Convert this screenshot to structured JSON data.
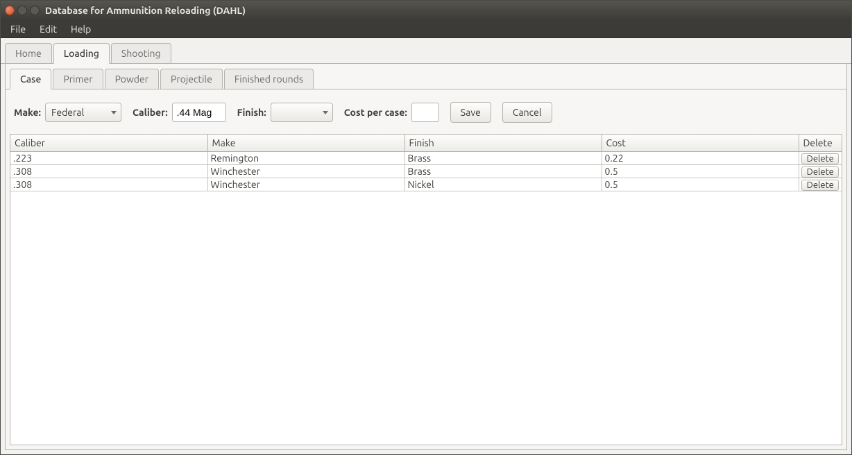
{
  "window": {
    "title": "Database for Ammunition Reloading (DAHL)"
  },
  "menubar": {
    "items": [
      "File",
      "Edit",
      "Help"
    ]
  },
  "primary_tabs": {
    "items": [
      "Home",
      "Loading",
      "Shooting"
    ],
    "active": "Loading"
  },
  "sub_tabs": {
    "items": [
      "Case",
      "Primer",
      "Powder",
      "Projectile",
      "Finished rounds"
    ],
    "active": "Case"
  },
  "form": {
    "make_label": "Make:",
    "make_value": "Federal",
    "caliber_label": "Caliber:",
    "caliber_value": ".44 Mag",
    "finish_label": "Finish:",
    "finish_value": "",
    "cost_label": "Cost per case:",
    "cost_value": "",
    "save_label": "Save",
    "cancel_label": "Cancel"
  },
  "table": {
    "headers": {
      "caliber": "Caliber",
      "make": "Make",
      "finish": "Finish",
      "cost": "Cost",
      "delete": "Delete"
    },
    "delete_btn_label": "Delete",
    "rows": [
      {
        "caliber": ".223",
        "make": "Remington",
        "finish": "Brass",
        "cost": "0.22"
      },
      {
        "caliber": ".308",
        "make": "Winchester",
        "finish": "Brass",
        "cost": "0.5"
      },
      {
        "caliber": ".308",
        "make": "Winchester",
        "finish": "Nickel",
        "cost": "0.5"
      }
    ]
  }
}
